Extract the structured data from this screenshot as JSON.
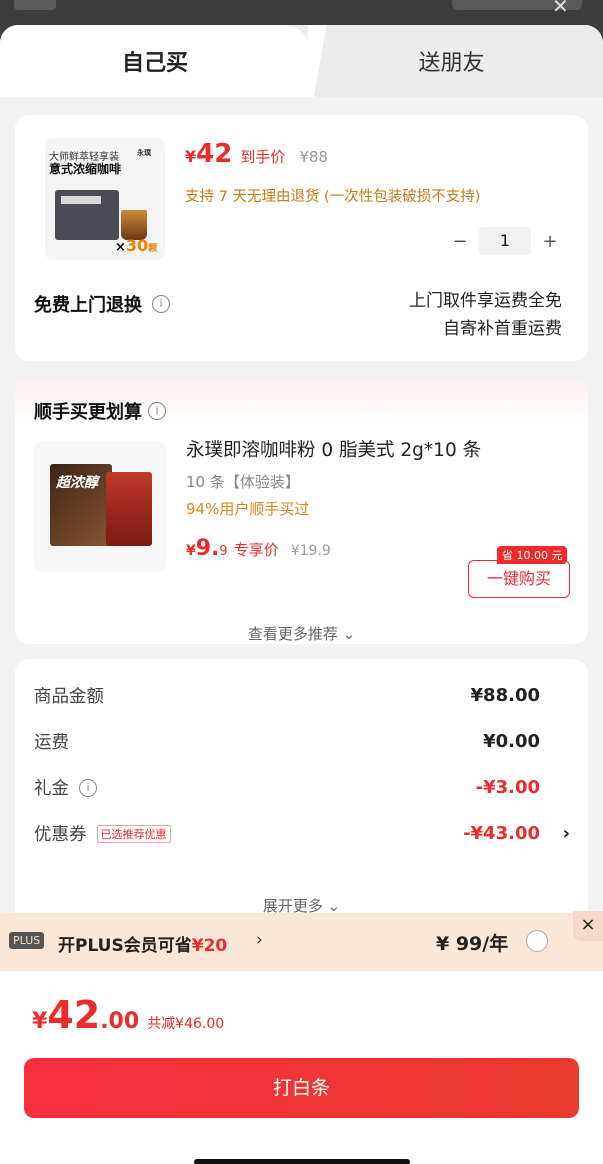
{
  "tabs": {
    "buy_self": "自己买",
    "send_friend": "送朋友"
  },
  "product": {
    "image_lines": {
      "line1": "大师鲜萃轻享装",
      "brand": "永璞",
      "line2": "意式浓缩咖啡",
      "count_prefix": "×",
      "count": "30",
      "count_unit": "颗"
    },
    "price_yen": "¥",
    "price": "42",
    "price_tag": "到手价",
    "original_price": "¥88",
    "return_note": "支持 7 天无理由退货 (一次性包装破损不支持)",
    "qty_minus": "−",
    "qty": "1",
    "qty_plus": "+",
    "free_return_label": "免费上门退换",
    "info_glyph": "i",
    "ship_line1": "上门取件享运费全免",
    "ship_line2": "自寄补首重运费"
  },
  "recommend": {
    "title": "顺手买更划算",
    "image_text": "超浓醇",
    "name": "永璞即溶咖啡粉 0 脂美式 2g*10 条",
    "spec": "10 条【体验装】",
    "rate": "94%用户顺手买过",
    "price_yen": "¥",
    "price_int": "9.",
    "price_dec": "9",
    "price_tag": "专享价",
    "original_price": "¥19.9",
    "save_badge": "省 10.00 元",
    "buy_button": "一键购买",
    "see_more": "查看更多推荐 ⌄"
  },
  "summary": {
    "rows": [
      {
        "label": "商品金额",
        "value": "¥88.00"
      },
      {
        "label": "运费",
        "value": "¥0.00"
      },
      {
        "label": "礼金",
        "value": "-¥3.00"
      },
      {
        "label": "优惠券",
        "chip": "已选推荐优惠",
        "value": "-¥43.00",
        "arrow": "›"
      }
    ],
    "expand": "展开更多 ⌄"
  },
  "plus": {
    "badge": "PLUS",
    "text": "开PLUS会员可省",
    "amount": "¥20",
    "chevron": "›",
    "fee": "¥ 99/年",
    "close": "×"
  },
  "footer": {
    "total_yen": "¥",
    "total_int": "42",
    "total_dec": ".00",
    "discount": "共减¥46.00",
    "pay_button": "打白条"
  },
  "colors": {
    "accent": "#ee2b2b",
    "orange": "#c77a1a",
    "plus_bg": "#fbe7d8"
  }
}
